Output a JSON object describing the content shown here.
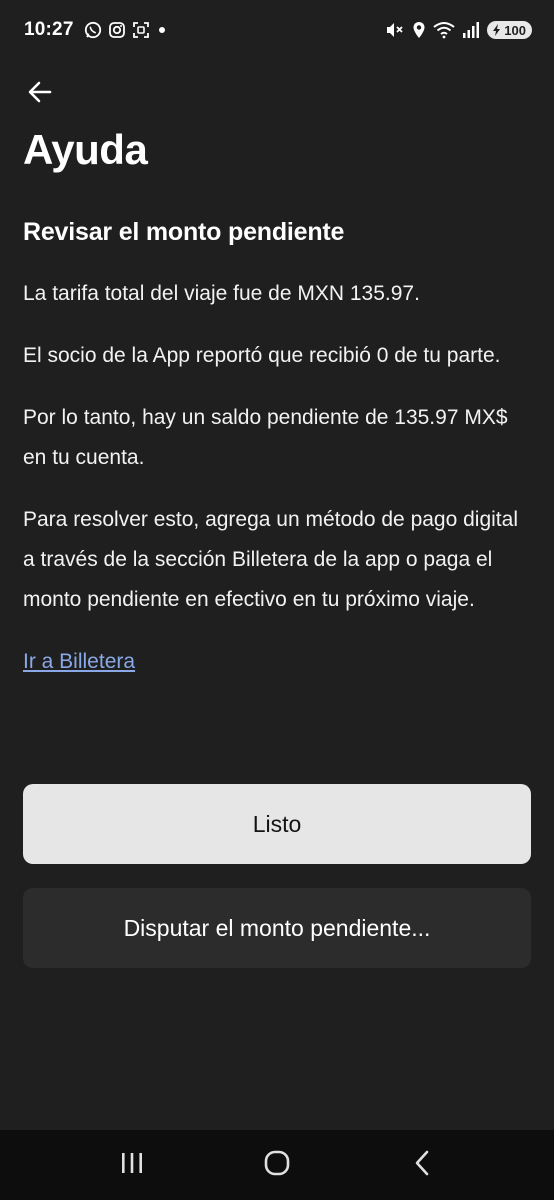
{
  "status_bar": {
    "time": "10:27",
    "battery": "100",
    "left_icons": [
      "whatsapp-icon",
      "instagram-icon",
      "screenshot-icon",
      "dot-icon"
    ],
    "right_icons": [
      "mute-icon",
      "location-icon",
      "wifi-icon",
      "signal-icon",
      "battery-icon"
    ]
  },
  "header": {
    "title": "Ayuda"
  },
  "content": {
    "section_title": "Revisar el monto pendiente",
    "paragraphs": [
      "La tarifa total del viaje fue de MXN 135.97.",
      "El socio de la App reportó que recibió 0 de tu parte.",
      "Por lo tanto, hay un saldo pendiente de 135.97 MX$ en tu cuenta.",
      "Para resolver esto, agrega un método de pago digital a través de la sección Billetera de la app o paga el monto pendiente en efectivo en tu próximo viaje."
    ],
    "wallet_link": "Ir a Billetera"
  },
  "actions": {
    "done_label": "Listo",
    "dispute_label": "Disputar el monto pendiente..."
  },
  "nav_bar": {
    "icons": [
      "recent-apps-icon",
      "home-icon",
      "back-nav-icon"
    ]
  },
  "colors": {
    "background": "#1f1f1f",
    "link": "#8aa8e6",
    "primary_button": "#e6e6e6",
    "secondary_button": "#2c2c2c",
    "nav_bar": "#0d0d0d"
  }
}
